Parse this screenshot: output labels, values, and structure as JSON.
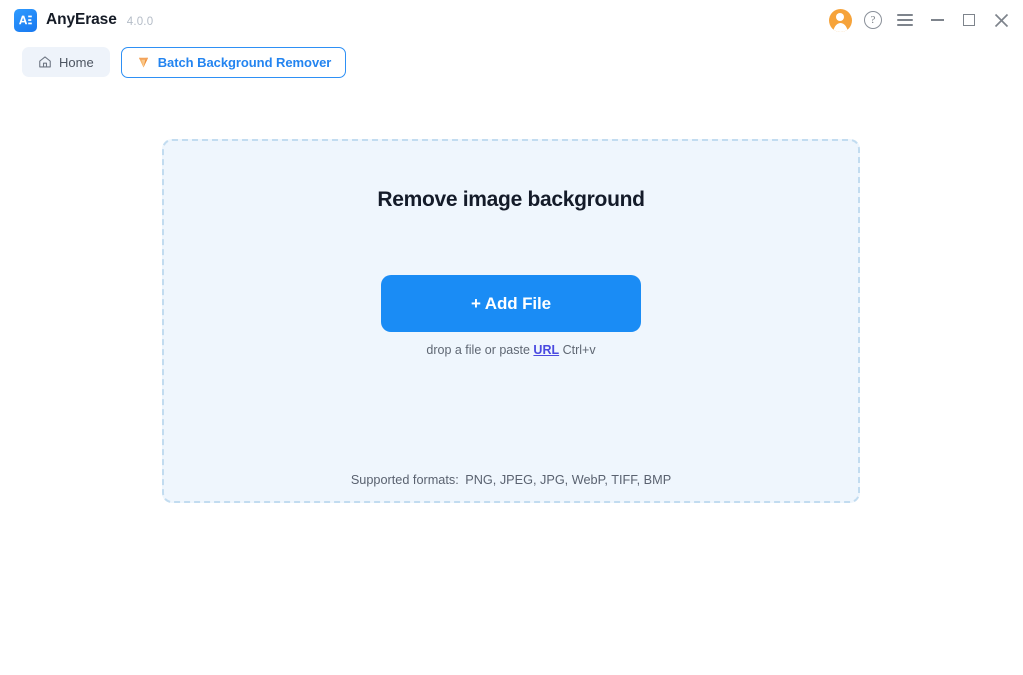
{
  "titlebar": {
    "app_name": "AnyErase",
    "version": "4.0.0",
    "logo_text": "AE",
    "controls": {
      "account_label": "Account",
      "help_label": "Help",
      "menu_label": "Menu",
      "minimize_label": "Minimize",
      "maximize_label": "Maximize",
      "close_label": "Close"
    }
  },
  "tabs": [
    {
      "id": "home",
      "label": "Home",
      "icon": "home-icon",
      "active": false
    },
    {
      "id": "batch",
      "label": "Batch Background Remover",
      "icon": "gem-icon",
      "active": true
    }
  ],
  "dropzone": {
    "title": "Remove image background",
    "add_file_label": "+ Add File",
    "hint_prefix": "drop a file or paste",
    "hint_link": "URL",
    "hint_suffix": "Ctrl+v",
    "formats_label": "Supported formats:",
    "formats_value": "PNG, JPEG, JPG, WebP, TIFF, BMP"
  },
  "colors": {
    "accent_blue": "#1a8cf5",
    "tab_border_blue": "#2e90f5",
    "tab_text_blue": "#2384f0",
    "avatar_orange": "#f6a33a",
    "gem_orange": "#f2994a",
    "dropzone_bg": "#eff6fd",
    "dropzone_border": "#c2dcf0",
    "link_purple": "#4a4ae0",
    "heading_dark": "#141b29"
  }
}
